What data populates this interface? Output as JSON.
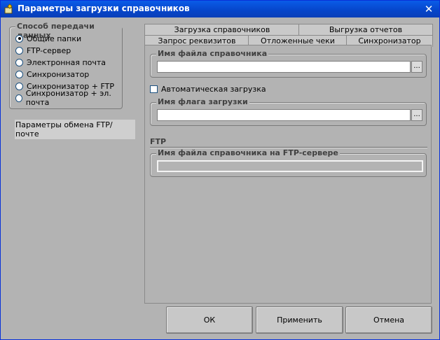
{
  "window": {
    "title": "Параметры загрузки справочников",
    "close_glyph": "✕"
  },
  "transfer_group": {
    "legend": "Способ передачи данных",
    "options": [
      {
        "label": "Общие папки",
        "selected": true
      },
      {
        "label": "FTP-сервер",
        "selected": false
      },
      {
        "label": "Электронная почта",
        "selected": false
      },
      {
        "label": "Синхронизатор",
        "selected": false
      },
      {
        "label": "Синхронизатор + FTP",
        "selected": false
      },
      {
        "label": "Синхронизатор + эл. почта",
        "selected": false
      }
    ]
  },
  "ftp_mail_button": "Параметры обмена FTP/почте",
  "tabs": {
    "row1": [
      "Загрузка справочников",
      "Выгрузка отчетов"
    ],
    "row2": [
      "Запрос реквизитов",
      "Отложенные чеки",
      "Синхронизатор"
    ],
    "active": "Загрузка справочников"
  },
  "panel": {
    "file_group": {
      "legend": "Имя файла справочника",
      "value": "",
      "browse": "..."
    },
    "auto_load": {
      "label": "Автоматическая загрузка",
      "checked": false
    },
    "flag_group": {
      "legend": "Имя флага загрузки",
      "value": "",
      "browse": "..."
    },
    "ftp_section": "FTP",
    "ftp_group": {
      "legend": "Имя файла справочника на FTP-сервере",
      "value": ""
    }
  },
  "buttons": {
    "ok": "ОК",
    "apply": "Применить",
    "cancel": "Отмена"
  }
}
